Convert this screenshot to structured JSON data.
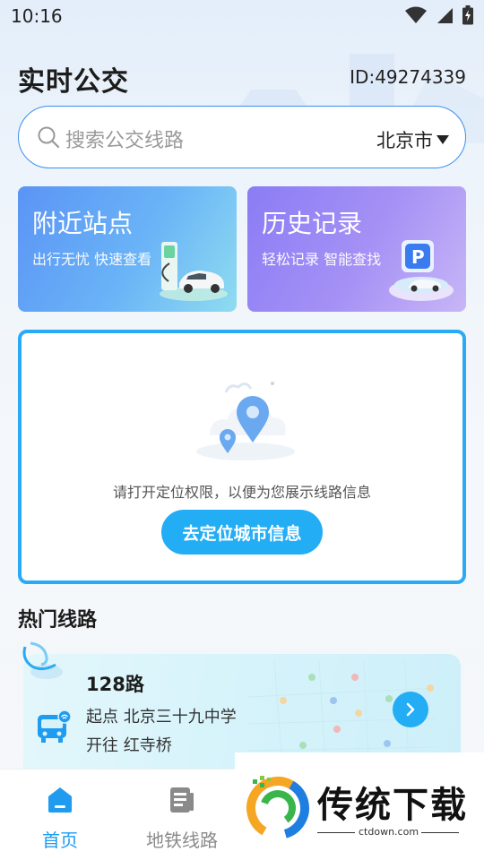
{
  "status_bar": {
    "time": "10:16"
  },
  "header": {
    "title": "实时公交",
    "user_id": "ID:49274339"
  },
  "search": {
    "placeholder": "搜索公交线路",
    "city": "北京市"
  },
  "feature_cards": [
    {
      "title": "附近站点",
      "subtitle": "出行无忧 快速查看"
    },
    {
      "title": "历史记录",
      "subtitle": "轻松记录 智能查找"
    }
  ],
  "location_prompt": {
    "message": "请打开定位权限，以便为您展示线路信息",
    "button_label": "去定位城市信息"
  },
  "hot_routes": {
    "section_title": "热门线路",
    "routes": [
      {
        "name": "128路",
        "start": "起点 北京三十九中学",
        "destination": "开往 红寺桥"
      }
    ]
  },
  "bottom_nav": {
    "items": [
      {
        "label": "首页",
        "active": true
      },
      {
        "label": "地铁线路",
        "active": false
      }
    ]
  },
  "watermark": {
    "text": "传统下载",
    "url": "ctdown.com"
  },
  "colors": {
    "accent": "#22adf5",
    "search_border": "#3a8ef0",
    "nav_active": "#1f9bf0"
  },
  "icons": [
    "wifi-icon",
    "signal-icon",
    "battery-icon",
    "search-icon",
    "dropdown-arrow-icon",
    "ev-charger-icon",
    "parking-icon",
    "location-pin-icon",
    "bus-icon",
    "arrow-right-icon",
    "home-icon",
    "metro-document-icon"
  ]
}
